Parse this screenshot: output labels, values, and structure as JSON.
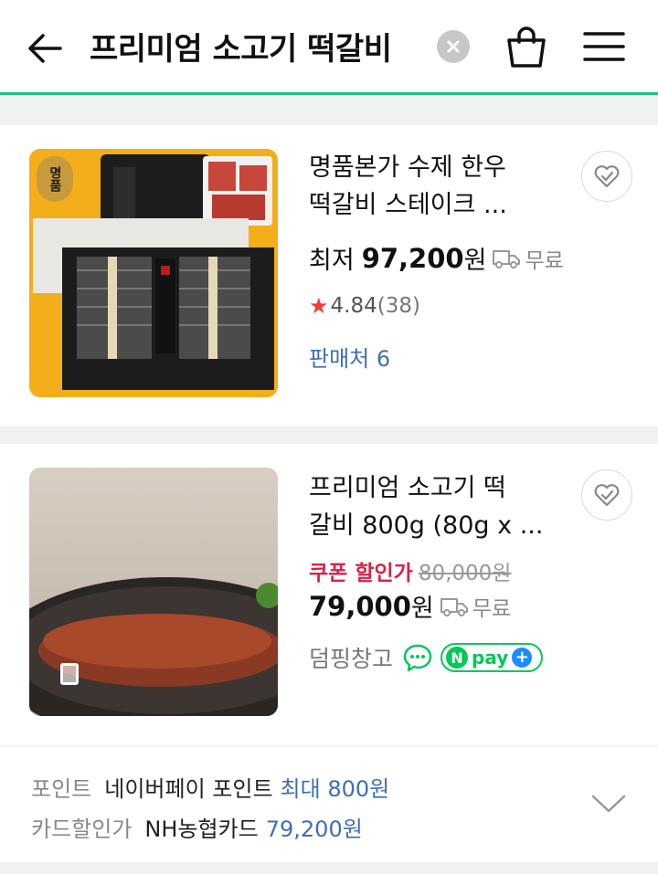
{
  "header": {
    "search_query": "프리미엄 소고기 떡갈비"
  },
  "products": [
    {
      "title_line1": "명품본가 수제 한우",
      "title_line2": "떡갈비 스테이크 ...",
      "price_label": "최저",
      "price": "97,200",
      "price_unit": "원",
      "shipping": "무료",
      "rating": "4.84",
      "review_count": "(38)",
      "sellers": "판매처 6",
      "badge": "명품"
    },
    {
      "title_line1": "프리미엄 소고기 떡",
      "title_line2": "갈비 800g (80g x ...",
      "coupon_label": "쿠폰 할인가",
      "original_price": "80,000원",
      "price": "79,000",
      "price_unit": "원",
      "shipping": "무료",
      "store": "덤핑창고",
      "npay": "pay"
    }
  ],
  "benefits": {
    "point_label": "포인트",
    "point_text": "네이버페이 포인트",
    "point_value": "최대 800원",
    "card_label": "카드할인가",
    "card_text": "NH농협카드",
    "card_value": "79,200원"
  },
  "colors": {
    "accent_green": "#19c37d",
    "link_blue": "#3d6fb8",
    "coupon_red": "#d7234a",
    "star_red": "#f03b3b"
  }
}
